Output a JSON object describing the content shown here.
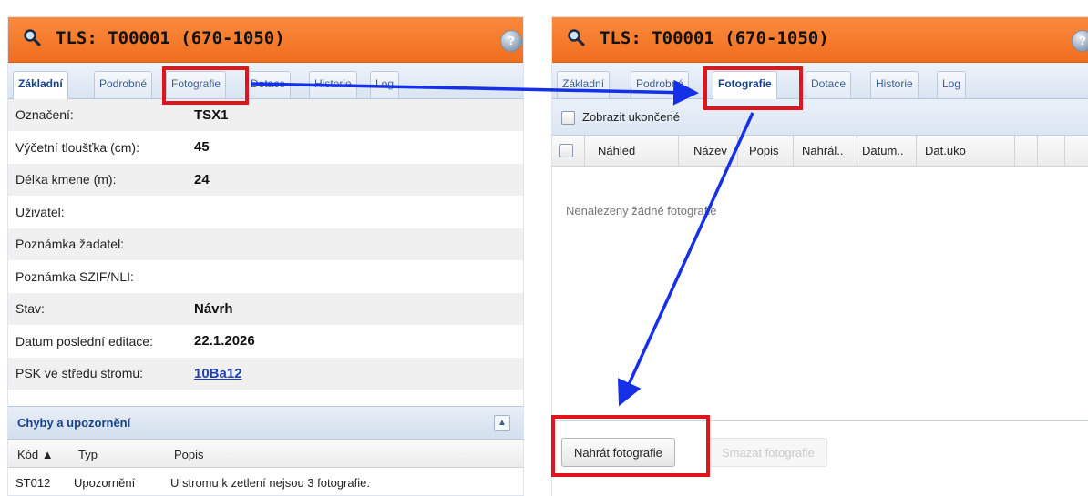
{
  "colors": {
    "titlebar": "#f47a2a",
    "tab_text": "#3b5f8f",
    "link": "#1d3fb8",
    "highlight": "#e0141a",
    "arrow": "#1530e8"
  },
  "left": {
    "title": "TLS: T00001 (670-1050)",
    "tabs": [
      {
        "label": "Základní",
        "active": true
      },
      {
        "label": "Podrobné",
        "active": false
      },
      {
        "label": "Fotografie",
        "active": false,
        "highlighted": true
      },
      {
        "label": "Dotace",
        "active": false
      },
      {
        "label": "Historie",
        "active": false
      },
      {
        "label": "Log",
        "active": false
      }
    ],
    "fields": [
      {
        "label": "Označení:",
        "value": "TSX1"
      },
      {
        "label": "Výčetní tloušťka (cm):",
        "value": "45"
      },
      {
        "label": "Délka kmene (m):",
        "value": "24"
      },
      {
        "label": "Uživatel:",
        "value": ""
      },
      {
        "label": "Poznámka žadatel:",
        "value": ""
      },
      {
        "label": "Poznámka SZIF/NLI:",
        "value": ""
      },
      {
        "label": "Stav:",
        "value": "Návrh"
      },
      {
        "label": "Datum poslední editace:",
        "value": "22.1.2026"
      },
      {
        "label": "PSK ve středu stromu:",
        "value": "10Ba12"
      }
    ],
    "errors_section": {
      "title": "Chyby a upozornění",
      "columns": [
        "Kód ▲",
        "Typ",
        "Popis"
      ],
      "rows": [
        {
          "code": "ST012",
          "type": "Upozornění",
          "description": "U stromu k zetlení nejsou 3 fotografie."
        }
      ]
    }
  },
  "right": {
    "title": "TLS: T00001 (670-1050)",
    "tabs": [
      {
        "label": "Základní",
        "active": false
      },
      {
        "label": "Podrobné",
        "active": false
      },
      {
        "label": "Fotografie",
        "active": true,
        "highlighted": true
      },
      {
        "label": "Dotace",
        "active": false
      },
      {
        "label": "Historie",
        "active": false
      },
      {
        "label": "Log",
        "active": false
      }
    ],
    "show_finished_label": "Zobrazit ukončené",
    "columns": [
      "Náhled",
      "Název",
      "Popis",
      "Nahrál..",
      "Datum..",
      "Dat.uko"
    ],
    "empty_message": "Nenalezeny žádné fotografie",
    "upload_button": "Nahrát fotografie",
    "delete_button": "Smazat fotografie"
  }
}
